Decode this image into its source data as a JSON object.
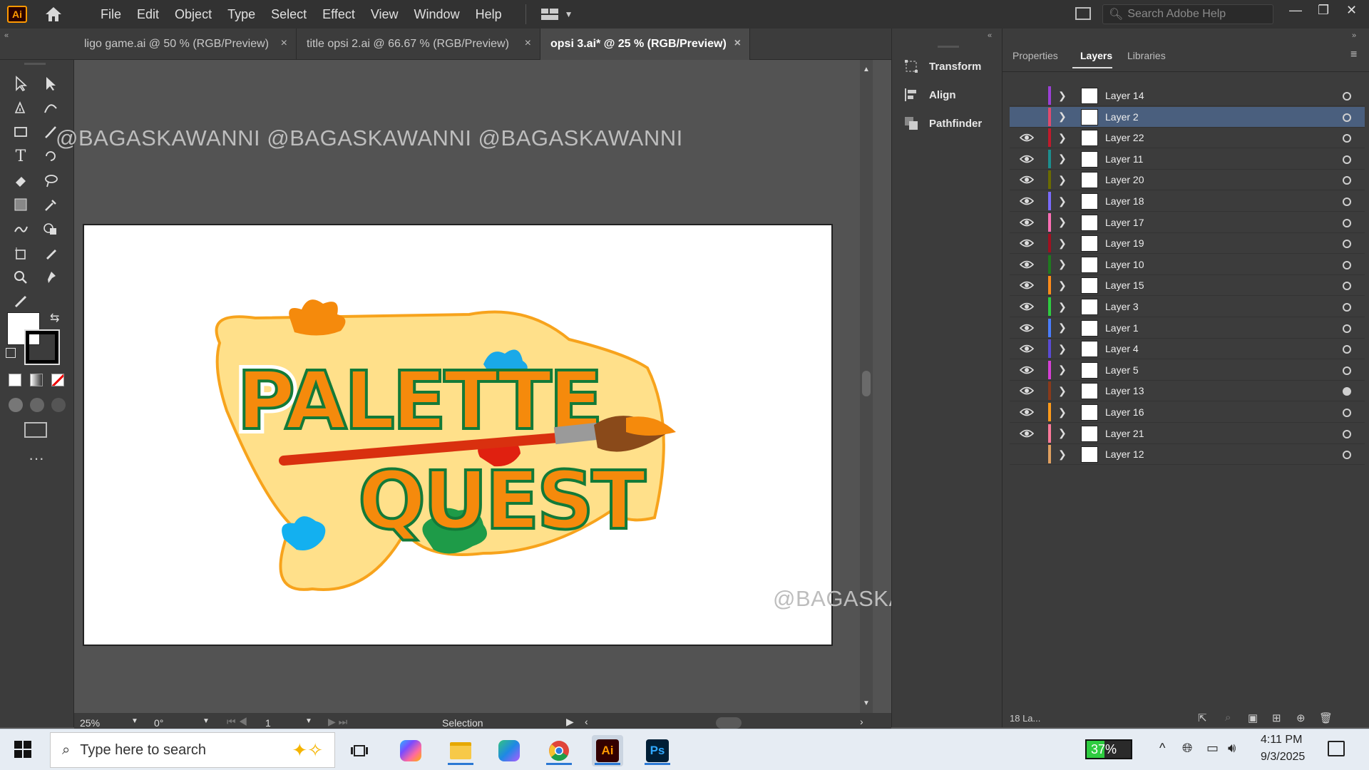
{
  "app": {
    "logo": "Ai"
  },
  "menu": [
    "File",
    "Edit",
    "Object",
    "Type",
    "Select",
    "Effect",
    "View",
    "Window",
    "Help"
  ],
  "search": {
    "placeholder": "Search Adobe Help"
  },
  "tabs": [
    {
      "label": "ligo game.ai @ 50 % (RGB/Preview)",
      "active": false
    },
    {
      "label": "title opsi 2.ai @ 66.67 % (RGB/Preview)",
      "active": false
    },
    {
      "label": "opsi 3.ai* @ 25 % (RGB/Preview)",
      "active": true
    }
  ],
  "watermark": "@BAGASKAWANNI @BAGASKAWANNI @BAGASKAWANNI",
  "watermark2": "@BAGASKAWANNI @BAGASKAWANNI @BAGASKAWANNI",
  "artwork": {
    "line1": "PALETTE",
    "line2": "QUEST"
  },
  "statusbar": {
    "zoom": "25%",
    "rotation": "0°",
    "artboard": "1",
    "tool": "Selection"
  },
  "midpanel": {
    "items": [
      "Transform",
      "Align",
      "Pathfinder"
    ]
  },
  "panel_tabs": [
    "Properties",
    "Layers",
    "Libraries"
  ],
  "layers": [
    {
      "name": "Layer 14",
      "color": "#9b3fd6",
      "visible": false,
      "selected": false
    },
    {
      "name": "Layer 2",
      "color": "#e24b6d",
      "visible": false,
      "selected": true
    },
    {
      "name": "Layer 22",
      "color": "#c01a2b",
      "visible": true,
      "selected": false
    },
    {
      "name": "Layer 11",
      "color": "#1c8f8f",
      "visible": true,
      "selected": false
    },
    {
      "name": "Layer 20",
      "color": "#6b6b00",
      "visible": true,
      "selected": false
    },
    {
      "name": "Layer 18",
      "color": "#7a6bff",
      "visible": true,
      "selected": false
    },
    {
      "name": "Layer 17",
      "color": "#ff6fb5",
      "visible": true,
      "selected": false
    },
    {
      "name": "Layer 19",
      "color": "#a01020",
      "visible": true,
      "selected": false
    },
    {
      "name": "Layer 10",
      "color": "#1f7a1f",
      "visible": true,
      "selected": false
    },
    {
      "name": "Layer 15",
      "color": "#ff8c1a",
      "visible": true,
      "selected": false
    },
    {
      "name": "Layer 3",
      "color": "#2ecc40",
      "visible": true,
      "selected": false
    },
    {
      "name": "Layer 1",
      "color": "#4a7dff",
      "visible": true,
      "selected": false
    },
    {
      "name": "Layer 4",
      "color": "#5a4bd6",
      "visible": true,
      "selected": false
    },
    {
      "name": "Layer 5",
      "color": "#d63fd6",
      "visible": true,
      "selected": false
    },
    {
      "name": "Layer 13",
      "color": "#8a3a1a",
      "visible": true,
      "selected": false
    },
    {
      "name": "Layer 16",
      "color": "#ff9a1a",
      "visible": true,
      "selected": false
    },
    {
      "name": "Layer 21",
      "color": "#ff7a9a",
      "visible": true,
      "selected": false
    },
    {
      "name": "Layer 12",
      "color": "#e0a060",
      "visible": false,
      "selected": false
    }
  ],
  "layers_footer": "18 La...",
  "taskbar": {
    "search_placeholder": "Type here to search",
    "battery": "37%",
    "time": "4:11 PM",
    "date": "9/3/2025"
  }
}
